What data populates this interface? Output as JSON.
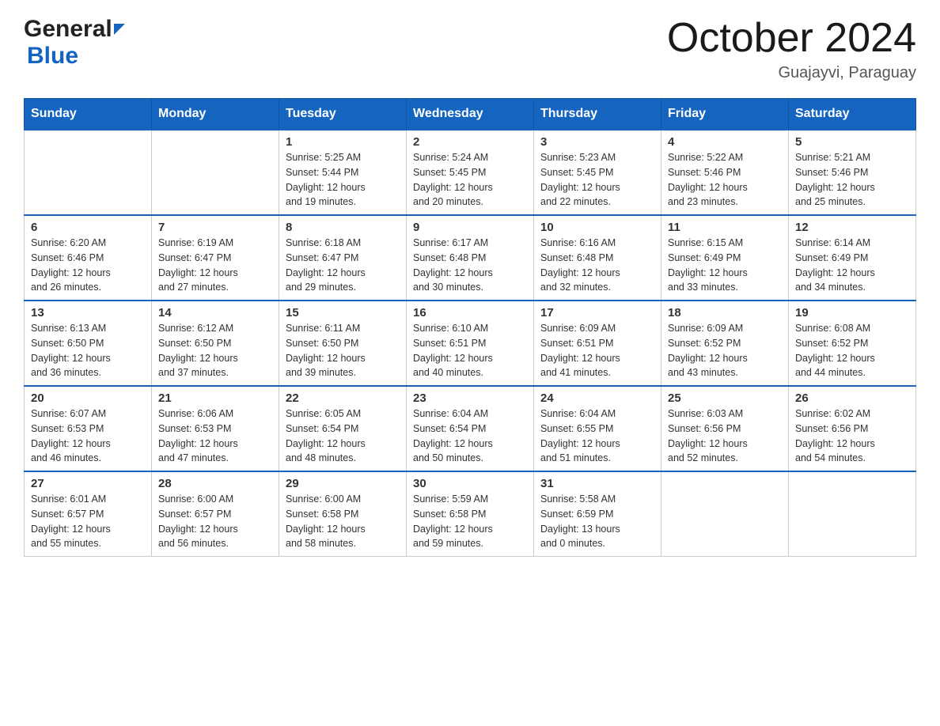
{
  "logo": {
    "general": "General",
    "blue": "Blue"
  },
  "title": "October 2024",
  "location": "Guajayvi, Paraguay",
  "headers": [
    "Sunday",
    "Monday",
    "Tuesday",
    "Wednesday",
    "Thursday",
    "Friday",
    "Saturday"
  ],
  "weeks": [
    [
      {
        "day": "",
        "info": ""
      },
      {
        "day": "",
        "info": ""
      },
      {
        "day": "1",
        "info": "Sunrise: 5:25 AM\nSunset: 5:44 PM\nDaylight: 12 hours\nand 19 minutes."
      },
      {
        "day": "2",
        "info": "Sunrise: 5:24 AM\nSunset: 5:45 PM\nDaylight: 12 hours\nand 20 minutes."
      },
      {
        "day": "3",
        "info": "Sunrise: 5:23 AM\nSunset: 5:45 PM\nDaylight: 12 hours\nand 22 minutes."
      },
      {
        "day": "4",
        "info": "Sunrise: 5:22 AM\nSunset: 5:46 PM\nDaylight: 12 hours\nand 23 minutes."
      },
      {
        "day": "5",
        "info": "Sunrise: 5:21 AM\nSunset: 5:46 PM\nDaylight: 12 hours\nand 25 minutes."
      }
    ],
    [
      {
        "day": "6",
        "info": "Sunrise: 6:20 AM\nSunset: 6:46 PM\nDaylight: 12 hours\nand 26 minutes."
      },
      {
        "day": "7",
        "info": "Sunrise: 6:19 AM\nSunset: 6:47 PM\nDaylight: 12 hours\nand 27 minutes."
      },
      {
        "day": "8",
        "info": "Sunrise: 6:18 AM\nSunset: 6:47 PM\nDaylight: 12 hours\nand 29 minutes."
      },
      {
        "day": "9",
        "info": "Sunrise: 6:17 AM\nSunset: 6:48 PM\nDaylight: 12 hours\nand 30 minutes."
      },
      {
        "day": "10",
        "info": "Sunrise: 6:16 AM\nSunset: 6:48 PM\nDaylight: 12 hours\nand 32 minutes."
      },
      {
        "day": "11",
        "info": "Sunrise: 6:15 AM\nSunset: 6:49 PM\nDaylight: 12 hours\nand 33 minutes."
      },
      {
        "day": "12",
        "info": "Sunrise: 6:14 AM\nSunset: 6:49 PM\nDaylight: 12 hours\nand 34 minutes."
      }
    ],
    [
      {
        "day": "13",
        "info": "Sunrise: 6:13 AM\nSunset: 6:50 PM\nDaylight: 12 hours\nand 36 minutes."
      },
      {
        "day": "14",
        "info": "Sunrise: 6:12 AM\nSunset: 6:50 PM\nDaylight: 12 hours\nand 37 minutes."
      },
      {
        "day": "15",
        "info": "Sunrise: 6:11 AM\nSunset: 6:50 PM\nDaylight: 12 hours\nand 39 minutes."
      },
      {
        "day": "16",
        "info": "Sunrise: 6:10 AM\nSunset: 6:51 PM\nDaylight: 12 hours\nand 40 minutes."
      },
      {
        "day": "17",
        "info": "Sunrise: 6:09 AM\nSunset: 6:51 PM\nDaylight: 12 hours\nand 41 minutes."
      },
      {
        "day": "18",
        "info": "Sunrise: 6:09 AM\nSunset: 6:52 PM\nDaylight: 12 hours\nand 43 minutes."
      },
      {
        "day": "19",
        "info": "Sunrise: 6:08 AM\nSunset: 6:52 PM\nDaylight: 12 hours\nand 44 minutes."
      }
    ],
    [
      {
        "day": "20",
        "info": "Sunrise: 6:07 AM\nSunset: 6:53 PM\nDaylight: 12 hours\nand 46 minutes."
      },
      {
        "day": "21",
        "info": "Sunrise: 6:06 AM\nSunset: 6:53 PM\nDaylight: 12 hours\nand 47 minutes."
      },
      {
        "day": "22",
        "info": "Sunrise: 6:05 AM\nSunset: 6:54 PM\nDaylight: 12 hours\nand 48 minutes."
      },
      {
        "day": "23",
        "info": "Sunrise: 6:04 AM\nSunset: 6:54 PM\nDaylight: 12 hours\nand 50 minutes."
      },
      {
        "day": "24",
        "info": "Sunrise: 6:04 AM\nSunset: 6:55 PM\nDaylight: 12 hours\nand 51 minutes."
      },
      {
        "day": "25",
        "info": "Sunrise: 6:03 AM\nSunset: 6:56 PM\nDaylight: 12 hours\nand 52 minutes."
      },
      {
        "day": "26",
        "info": "Sunrise: 6:02 AM\nSunset: 6:56 PM\nDaylight: 12 hours\nand 54 minutes."
      }
    ],
    [
      {
        "day": "27",
        "info": "Sunrise: 6:01 AM\nSunset: 6:57 PM\nDaylight: 12 hours\nand 55 minutes."
      },
      {
        "day": "28",
        "info": "Sunrise: 6:00 AM\nSunset: 6:57 PM\nDaylight: 12 hours\nand 56 minutes."
      },
      {
        "day": "29",
        "info": "Sunrise: 6:00 AM\nSunset: 6:58 PM\nDaylight: 12 hours\nand 58 minutes."
      },
      {
        "day": "30",
        "info": "Sunrise: 5:59 AM\nSunset: 6:58 PM\nDaylight: 12 hours\nand 59 minutes."
      },
      {
        "day": "31",
        "info": "Sunrise: 5:58 AM\nSunset: 6:59 PM\nDaylight: 13 hours\nand 0 minutes."
      },
      {
        "day": "",
        "info": ""
      },
      {
        "day": "",
        "info": ""
      }
    ]
  ]
}
